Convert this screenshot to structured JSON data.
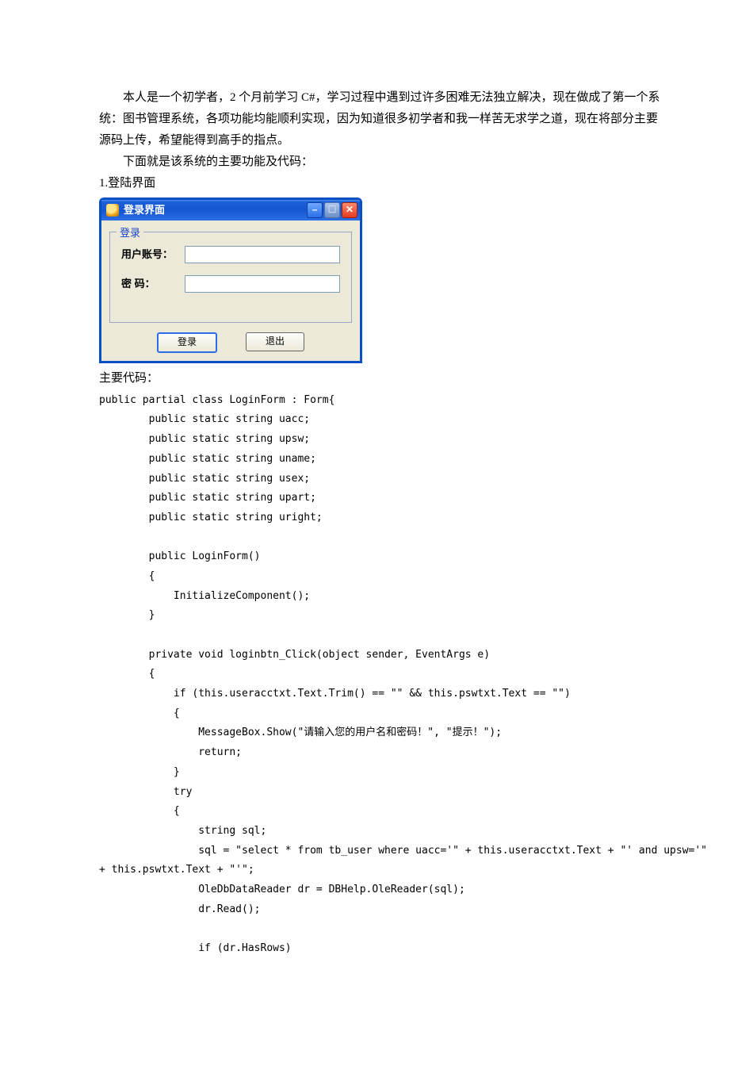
{
  "para1": "本人是一个初学者，2 个月前学习 C#，学习过程中遇到过许多困难无法独立解决，现在做成了第一个系统：图书管理系统，各项功能均能顺利实现，因为知道很多初学者和我一样苦无求学之道，现在将部分主要源码上传，希望能得到高手的指点。",
  "para2": "下面就是该系统的主要功能及代码：",
  "sec1": "1.登陆界面",
  "window": {
    "title": "登录界面",
    "group": "登录",
    "label_user": "用户账号：",
    "label_pwd": "密    码：",
    "btn_login": "登录",
    "btn_exit": "退出"
  },
  "label_maincode": "主要代码：",
  "code": "public partial class LoginForm : Form{\n        public static string uacc;\n        public static string upsw;\n        public static string uname;\n        public static string usex;\n        public static string upart;\n        public static string uright;\n\n        public LoginForm()\n        {\n            InitializeComponent();\n        }\n\n        private void loginbtn_Click(object sender, EventArgs e)\n        {\n            if (this.useracctxt.Text.Trim() == \"\" && this.pswtxt.Text == \"\")\n            {\n                MessageBox.Show(\"请输入您的用户名和密码！\", \"提示！\");\n                return;\n            }\n            try\n            {\n                string sql;\n                sql = \"select * from tb_user where uacc='\" + this.useracctxt.Text + \"' and upsw='\"\n+ this.pswtxt.Text + \"'\";\n                OleDbDataReader dr = DBHelp.OleReader(sql);\n                dr.Read();\n\n                if (dr.HasRows)"
}
